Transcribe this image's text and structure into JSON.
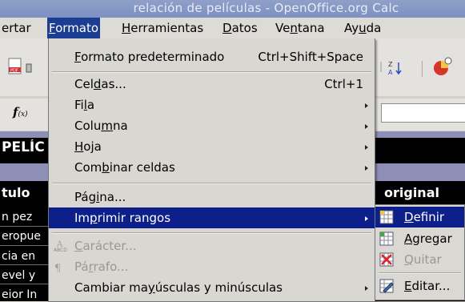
{
  "window": {
    "title": "relación de películas - OpenOffice.org Calc"
  },
  "menubar": {
    "items": [
      {
        "label": "ertar"
      },
      {
        "label": "Formato",
        "active": true
      },
      {
        "label": "Herramientas"
      },
      {
        "label": "Datos"
      },
      {
        "label": "Ventana"
      },
      {
        "label": "Ayuda"
      }
    ]
  },
  "formula_bar": {
    "fx_label": "f",
    "fx_suffix": "(x)"
  },
  "sheet": {
    "title_cell": "PELÍC",
    "header_left": "tulo",
    "header_right": "original",
    "rows": [
      "n pez",
      "eropue",
      "cia en",
      "evel y",
      "eior In"
    ]
  },
  "format_menu": {
    "items": [
      {
        "label": "Formato predeterminado",
        "shortcut": "Ctrl+Shift+Space",
        "mnemonic_index": 0
      },
      {
        "label": "Celdas...",
        "shortcut": "Ctrl+1",
        "mnemonic_index": 3
      },
      {
        "label": "Fila",
        "submenu": true,
        "mnemonic_index": 2
      },
      {
        "label": "Columna",
        "submenu": true,
        "mnemonic_index": 4
      },
      {
        "label": "Hoja",
        "submenu": true,
        "mnemonic_index": 0
      },
      {
        "label": "Combinar celdas",
        "submenu": true,
        "mnemonic_index": 3
      },
      {
        "label": "Página...",
        "mnemonic_index": 3
      },
      {
        "label": "Imprimir rangos",
        "submenu": true,
        "highlighted": true,
        "mnemonic_index": 2
      },
      {
        "label": "Carácter...",
        "disabled": true,
        "icon": "character-icon",
        "mnemonic_index": 0
      },
      {
        "label": "Párrafo...",
        "disabled": true,
        "icon": "paragraph-icon",
        "mnemonic_index": 2
      },
      {
        "label": "Cambiar mayúsculas y minúsculas",
        "submenu": true,
        "mnemonic_index": 10
      }
    ]
  },
  "print_ranges_submenu": {
    "items": [
      {
        "label": "Definir",
        "highlighted": true,
        "icon": "define-range-icon",
        "mnemonic_index": 0
      },
      {
        "label": "Agregar",
        "icon": "add-range-icon",
        "mnemonic_index": 0
      },
      {
        "label": "Quitar",
        "disabled": true,
        "icon": "remove-range-icon",
        "mnemonic_index": 0
      },
      {
        "label": "Editar...",
        "icon": "edit-range-icon",
        "mnemonic_index": 0
      }
    ]
  },
  "colors": {
    "highlight": "#0c1f8a",
    "menu_bg": "#d9d7d2",
    "titlebar": "#7d90c0",
    "sheet_band": "#8d8fb7"
  }
}
